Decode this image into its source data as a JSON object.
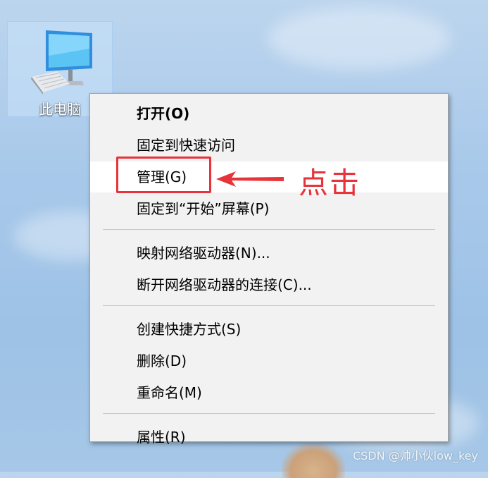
{
  "desktop": {
    "icon_label": "此电脑",
    "icon_name": "computer-icon"
  },
  "context_menu": {
    "groups": [
      [
        {
          "label": "打开(O)",
          "bold": true
        },
        {
          "label": "固定到快速访问"
        },
        {
          "label": "管理(G)",
          "highlighted": true
        },
        {
          "label": "固定到“开始”屏幕(P)"
        }
      ],
      [
        {
          "label": "映射网络驱动器(N)..."
        },
        {
          "label": "断开网络驱动器的连接(C)..."
        }
      ],
      [
        {
          "label": "创建快捷方式(S)"
        },
        {
          "label": "删除(D)"
        },
        {
          "label": "重命名(M)"
        }
      ],
      [
        {
          "label": "属性(R)"
        }
      ]
    ]
  },
  "annotation": {
    "text": "点击",
    "color": "#e8333a"
  },
  "watermark": "CSDN @帅小伙low_key"
}
